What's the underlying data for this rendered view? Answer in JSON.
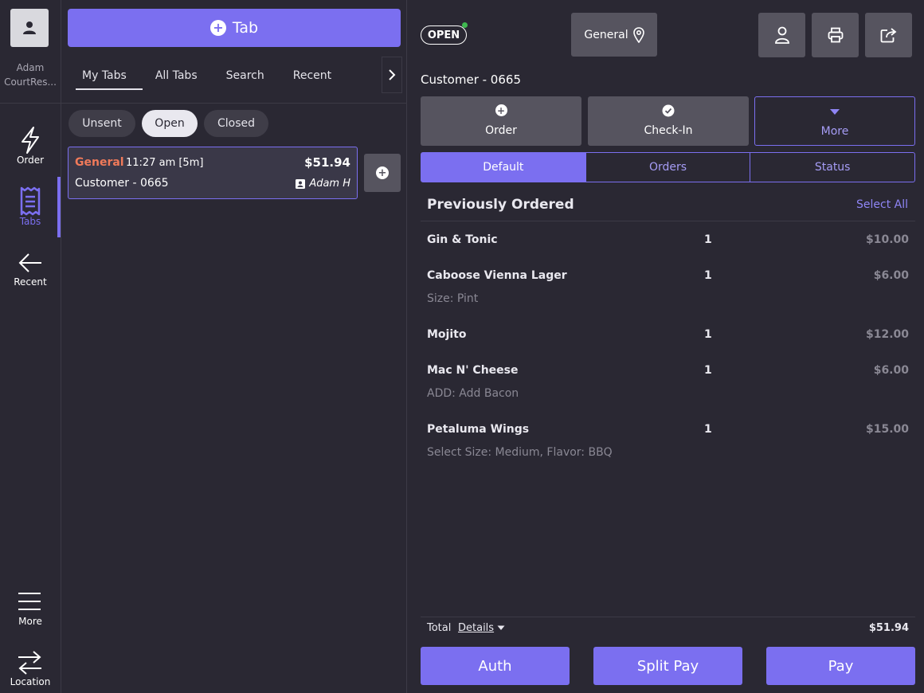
{
  "user": {
    "name": "Adam\nCourtRes..."
  },
  "nav": {
    "order": "Order",
    "tabs": "Tabs",
    "recent": "Recent",
    "more": "More",
    "location": "Location"
  },
  "tabs_panel": {
    "new_tab_label": "Tab",
    "segments": [
      "My Tabs",
      "All Tabs",
      "Search",
      "Recent"
    ],
    "filters": [
      "Unsent",
      "Open",
      "Closed"
    ],
    "active_filter": "Open",
    "cards": [
      {
        "location": "General",
        "time": "11:27 am [5m]",
        "total": "$51.94",
        "customer": "Customer - 0665",
        "server": "Adam H"
      }
    ]
  },
  "detail": {
    "status": "OPEN",
    "location": "General",
    "customer": "Customer - 0665",
    "actions": {
      "order": "Order",
      "checkin": "Check-In",
      "more": "More"
    },
    "views": [
      "Default",
      "Orders",
      "Status"
    ],
    "active_view": "Default",
    "section_title": "Previously Ordered",
    "select_all": "Select All",
    "items": [
      {
        "name": "Gin & Tonic",
        "qty": "1",
        "price": "$10.00",
        "modifier": ""
      },
      {
        "name": "Caboose Vienna Lager",
        "qty": "1",
        "price": "$6.00",
        "modifier": "Size: Pint"
      },
      {
        "name": "Mojito",
        "qty": "1",
        "price": "$12.00",
        "modifier": ""
      },
      {
        "name": "Mac N' Cheese",
        "qty": "1",
        "price": "$6.00",
        "modifier": "ADD: Add Bacon"
      },
      {
        "name": "Petaluma Wings",
        "qty": "1",
        "price": "$15.00",
        "modifier": "Select Size: Medium, Flavor: BBQ"
      }
    ],
    "total_label": "Total",
    "details_label": "Details",
    "total": "$51.94",
    "buttons": {
      "auth": "Auth",
      "split": "Split Pay",
      "pay": "Pay"
    }
  },
  "colors": {
    "accent": "#7b6ff0",
    "background": "#2a2833",
    "location_highlight": "#f07a5a",
    "open_indicator": "#3fb950"
  }
}
